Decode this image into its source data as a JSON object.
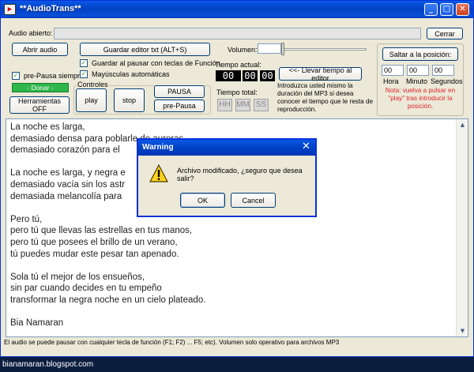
{
  "window": {
    "title": "**AudioTrans**"
  },
  "titlebar_buttons": {
    "minimize": "_",
    "maximize": "□",
    "close": "✕"
  },
  "icons": {
    "app": "app-icon",
    "warning": "warning-icon"
  },
  "audio": {
    "label": "Audio abierto:",
    "value": "",
    "close_label": "Cerrar"
  },
  "buttons": {
    "open_audio": "Abrir audio",
    "save_editor": "Guardar editor txt (ALT+S)",
    "donate": "- Donar -",
    "tools": "Herramientas OFF",
    "play": "play",
    "stop": "stop",
    "pause": "PAUSA",
    "pre_pause": "pre-Pausa",
    "bring_time": "<<- Llevar tiempo al editor",
    "jump": "Saltar a la posición:"
  },
  "checkboxes": {
    "pre_pause_always": {
      "label": "pre-Pausa siempre",
      "checked": true
    },
    "save_on_pause": {
      "label": "Guardar al pausar con teclas de Función",
      "checked": true
    },
    "auto_caps": {
      "label": "Mayúsculas automáticas",
      "checked": true
    }
  },
  "controls_group": {
    "label": "Controles"
  },
  "volume": {
    "label": "Volumen:",
    "level": 0.22
  },
  "current_time": {
    "label": "Tiempo actual:",
    "hh": "00",
    "mm": "00",
    "ss": "00"
  },
  "total_time": {
    "label": "Tiempo total:",
    "hh": "HH",
    "mm": "MM",
    "ss": "SS"
  },
  "help_text": "Introduzca usted mismo la duración del MP3 si desea conocer el tiempo que le resta de reproducción.",
  "position": {
    "hora_value": "00",
    "minuto_value": "00",
    "segundos_value": "00",
    "hora_label": "Hora",
    "minuto_label": "Minuto",
    "segundos_label": "Segundos",
    "note": "Nota: vuelva a pulsar en \"play\" tras introducir la posición."
  },
  "editor": {
    "lines": [
      "La noche es larga,",
      "demasiado densa para poblarle de auroras,",
      "demasiado corazón para el",
      "",
      "La noche es larga, y negra e",
      "demasiado vacía sin los astr",
      "demasiada melancolía para",
      "",
      "Pero tú,",
      "pero tú que llevas las estrellas en tus manos,",
      "pero tú que posees el brillo de un verano,",
      "tú puedes mudar este pesar tan apenado.",
      "",
      "Sola tú el mejor de los ensueños,",
      "sin par cuando decides en tu empeño",
      "transformar la negra noche en un cielo plateado.",
      "",
      "Bia Namaran"
    ]
  },
  "status": "El audio se puede pausar con cualquier tecla de función (F1; F2) ... F5; etc). Volumen solo operativo para archivos MP3",
  "footer": "bianamaran.blogspot.com",
  "dialog": {
    "title": "Warning",
    "message": "Archivo modificado, ¿seguro que desea salir?",
    "ok": "OK",
    "cancel": "Cancel",
    "close": "✕"
  },
  "colors": {
    "title_blue": "#0142c4",
    "donate_green": "#2db64a",
    "note_red": "#e0242a",
    "time_black": "#000000"
  }
}
